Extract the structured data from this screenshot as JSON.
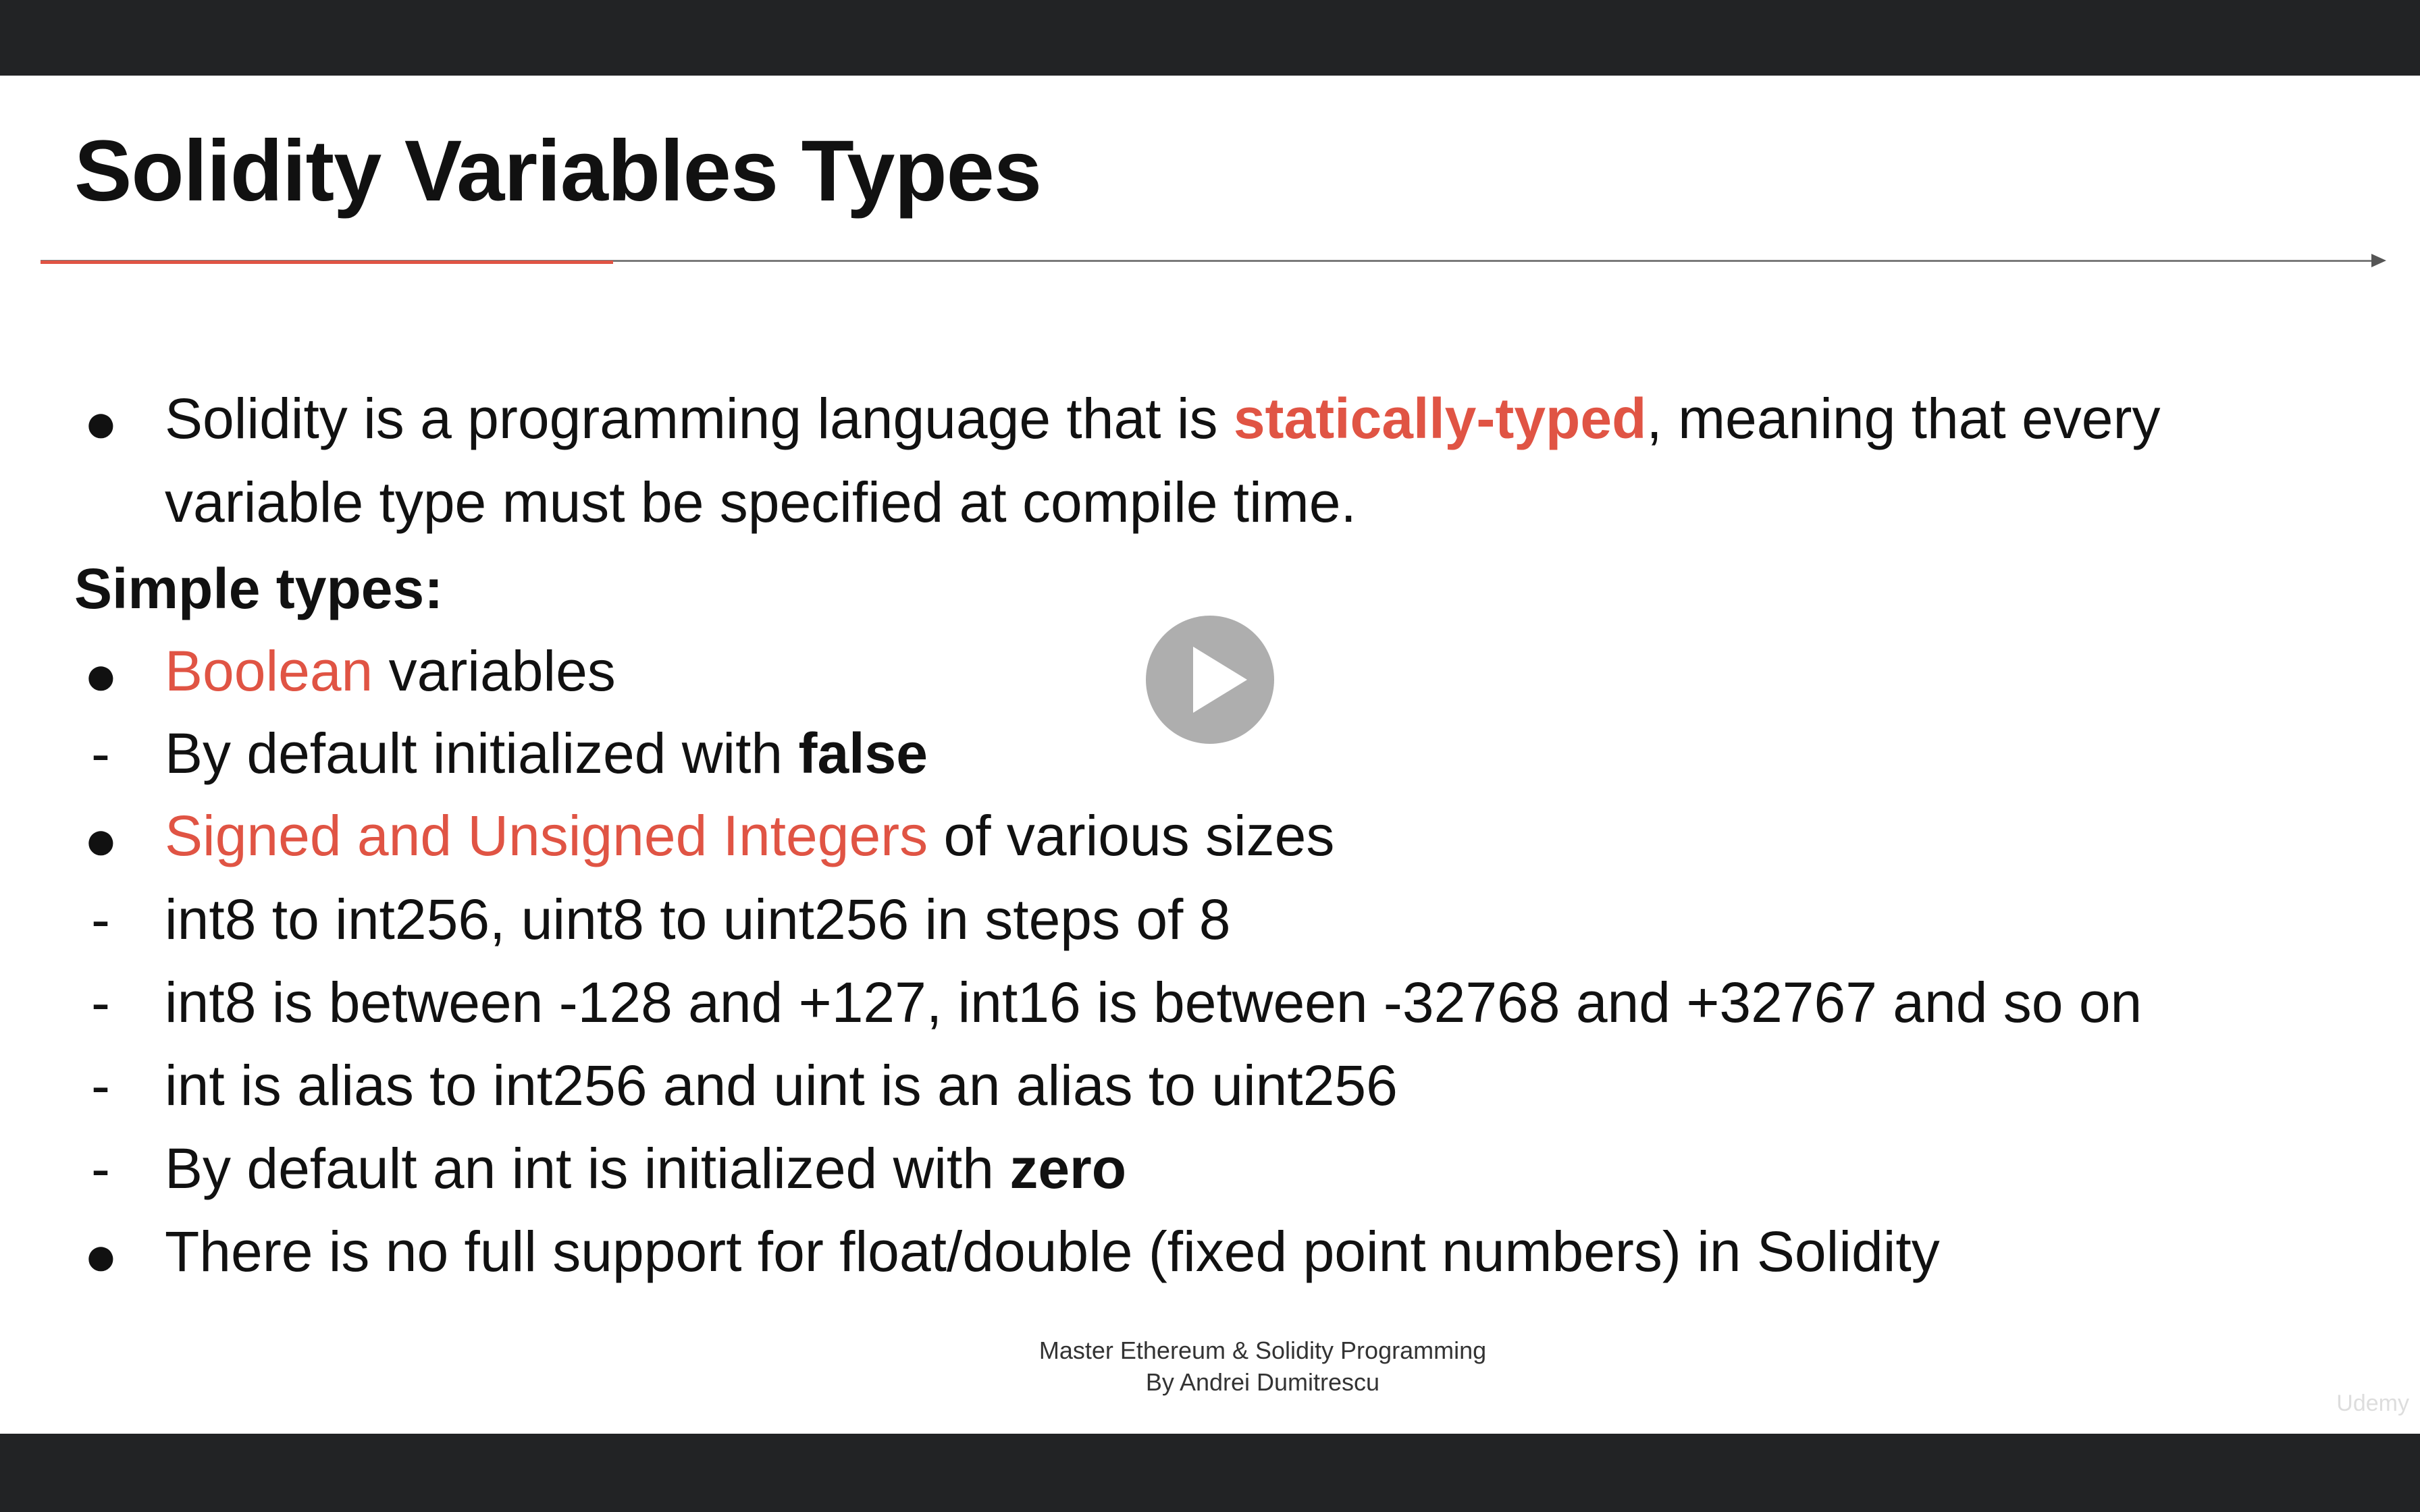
{
  "slide": {
    "title": "Solidity Variables Types",
    "intro": {
      "line1_pre": "Solidity is a programming language that is ",
      "line1_highlight": "statically-typed",
      "line1_post": ", meaning that every",
      "line2": "variable type must be specified at compile time."
    },
    "section_heading": "Simple types:",
    "items": {
      "boolean": {
        "marker": "●",
        "highlight": "Boolean",
        "rest": " variables"
      },
      "boolean_default": {
        "marker": "-",
        "pre": "By default initialized with ",
        "bold": "false"
      },
      "integers": {
        "marker": "●",
        "highlight": "Signed and Unsigned Integers",
        "rest": " of various sizes"
      },
      "int_steps": {
        "marker": "-",
        "text": "int8 to int256, uint8 to uint256 in steps of 8"
      },
      "int_ranges": {
        "marker": "-",
        "text": "int8 is between -128 and +127, int16 is between -32768 and +32767 and so on"
      },
      "int_alias": {
        "marker": "-",
        "text": "int is alias to int256 and uint is an alias to uint256"
      },
      "int_default": {
        "marker": "-",
        "pre": "By default an int is initialized with ",
        "bold": "zero"
      },
      "float": {
        "marker": "●",
        "text": "There is no full support for float/double (fixed point numbers) in Solidity"
      }
    },
    "footer": {
      "line1": "Master Ethereum & Solidity Programming",
      "line2": "By Andrei Dumitrescu"
    },
    "watermark": "Udemy"
  },
  "colors": {
    "accent": "#e05444",
    "text": "#111111",
    "letterbox": "#222325"
  },
  "player": {
    "icon": "play-icon"
  }
}
